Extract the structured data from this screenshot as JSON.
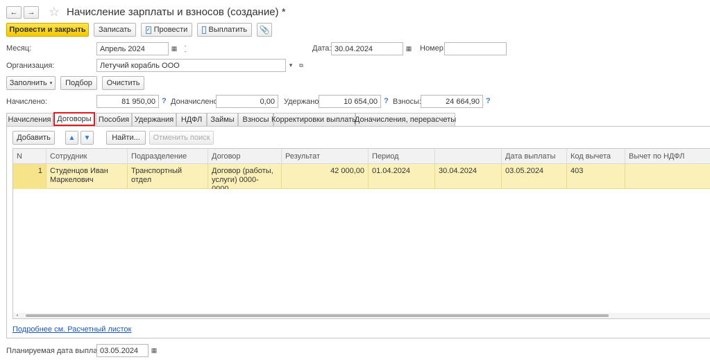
{
  "window": {
    "title": "Начисление зарплаты и взносов (создание) *"
  },
  "toolbar": {
    "post_close": "Провести и закрыть",
    "save": "Записать",
    "post": "Провести",
    "pay": "Выплатить"
  },
  "header": {
    "month_label": "Месяц:",
    "month_value": "Апрель 2024",
    "date_label": "Дата:",
    "date_value": "30.04.2024",
    "number_label": "Номер:",
    "number_value": "",
    "org_label": "Организация:",
    "org_value": "Летучий корабль ООО"
  },
  "actions": {
    "fill": "Заполнить",
    "select": "Подбор",
    "clear": "Очистить"
  },
  "totals": {
    "accrued_label": "Начислено:",
    "accrued_value": "81 950,00",
    "additional_label": "Доначислено:",
    "additional_value": "0,00",
    "withheld_label": "Удержано:",
    "withheld_value": "10 654,00",
    "contrib_label": "Взносы:",
    "contrib_value": "24 664,90",
    "help": "?"
  },
  "tabs": [
    "Начисления",
    "Договоры",
    "Пособия",
    "Удержания",
    "НДФЛ",
    "Займы",
    "Взносы",
    "Корректировки выплаты",
    "Доначисления, перерасчеты"
  ],
  "tab_toolbar": {
    "add": "Добавить",
    "find": "Найти...",
    "cancel_search": "Отменить поиск"
  },
  "table": {
    "columns": [
      "N",
      "Сотрудник",
      "Подразделение",
      "Договор",
      "Результат",
      "Период",
      "",
      "Дата выплаты",
      "Код вычета",
      "Вычет по НДФЛ"
    ],
    "rows": [
      {
        "n": "1",
        "employee": "Студенцов Иван Маркелович",
        "department": "Транспортный отдел",
        "contract": "Договор (работы, услуги) 0000-0000…",
        "result": "42 000,00",
        "period_start": "01.04.2024",
        "period_end": "30.04.2024",
        "pay_date": "03.05.2024",
        "deduction_code": "403",
        "ndfl_deduction": ""
      }
    ]
  },
  "footer": {
    "details_link": "Подробнее см. Расчетный листок",
    "planned_label": "Планируемая дата выплаты:",
    "planned_value": "03.05.2024"
  }
}
